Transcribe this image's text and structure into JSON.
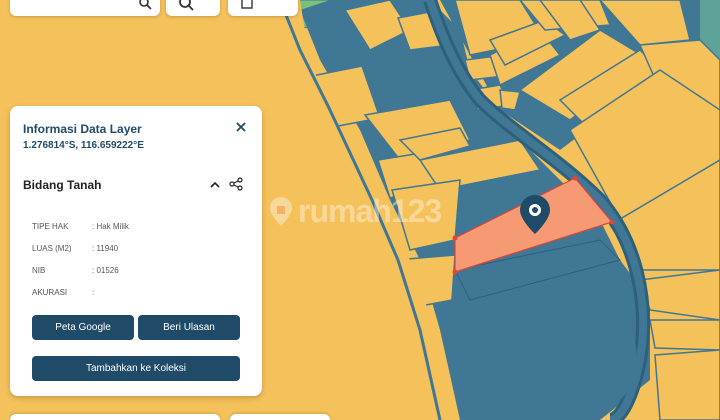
{
  "colors": {
    "parcel_yellow": "#f5c15a",
    "parcel_blue": "#3f7795",
    "parcel_selected": "#f59a72",
    "green_area": "#7dc07a",
    "dark_blue": "#1f4a68",
    "selected_vertex": "#e0443a"
  },
  "icons": [
    "search-icon",
    "layers-icon",
    "close-icon",
    "chevron-up-icon",
    "share-icon",
    "map-pin-icon",
    "watermark-pin-icon"
  ],
  "info_panel": {
    "title": "Informasi Data Layer",
    "coords": "1.276814°S, 116.659222°E",
    "section_title": "Bidang Tanah",
    "rows": [
      {
        "label": "TIPE HAK",
        "value": ": Hak Milik"
      },
      {
        "label": "LUAS (M2)",
        "value": ": 11940"
      },
      {
        "label": "NIB",
        "value": ": 01526"
      },
      {
        "label": "AKURASI",
        "value": ":"
      }
    ],
    "btn_google": "Peta Google",
    "btn_review": "Beri Ulasan",
    "btn_collection": "Tambahkan ke Koleksi"
  },
  "watermark": "rumah123"
}
